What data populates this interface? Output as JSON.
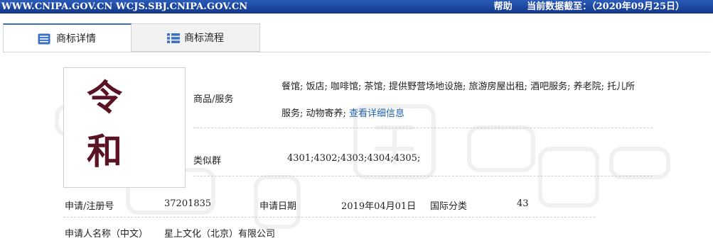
{
  "topbar": {
    "sites": "WWW.CNIPA.GOV.CN WCJS.SBJ.CNIPA.GOV.CN",
    "help": "帮助",
    "data_as_of": "当前数据截至：（2020年09月25日）"
  },
  "tabs": [
    {
      "label": "商标详情",
      "icon": "document-list-icon"
    },
    {
      "label": "商标流程",
      "icon": "list-icon"
    }
  ],
  "mark": {
    "char1": "令",
    "char2": "和"
  },
  "goods": {
    "label": "商品/服务",
    "line1": "餐馆; 饭店; 咖啡馆; 茶馆; 提供野营场地设施; 旅游房屋出租; 酒吧服务; 养老院; 托儿所",
    "line2": "服务; 动物寄养; ",
    "detail_link": "查看详细信息"
  },
  "similar_group": {
    "label": "类似群",
    "value": "4301;4302;4303;4304;4305;"
  },
  "registration": {
    "reg_no_label": "申请/注册号",
    "reg_no": "37201835",
    "date_label": "申请日期",
    "date": "2019年04月01日",
    "class_label": "国际分类",
    "class": "43"
  },
  "applicant": {
    "label": "申请人名称（中文）",
    "value": "星上文化（北京）有限公司"
  },
  "colors": {
    "topbar": "#1f4ea6",
    "accent": "#3a6fc8",
    "link": "#1c5fb4",
    "mark": "#5a1224"
  }
}
